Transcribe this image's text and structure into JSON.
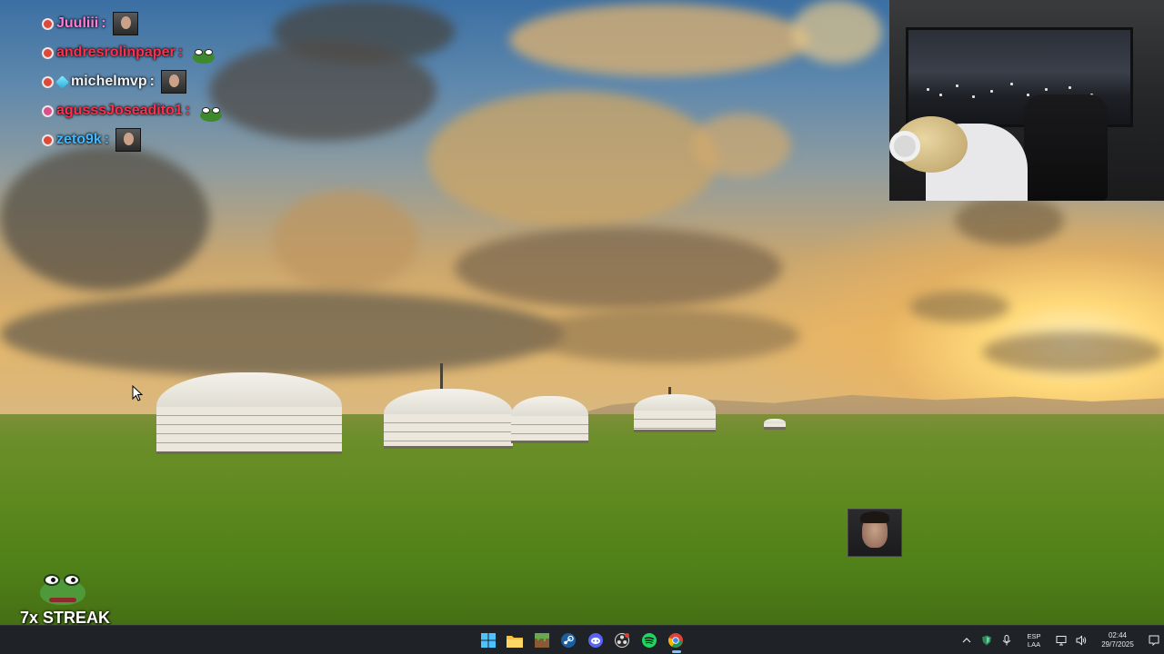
{
  "chat": {
    "messages": [
      {
        "user": "Juuliii",
        "color": "#ff7ad9",
        "badge_color": "#e0483a",
        "emote": "face"
      },
      {
        "user": "andresrolinpaper",
        "color": "#ff2e4c",
        "badge_color": "#e0483a",
        "emote": "pepe"
      },
      {
        "user": "michelmvp",
        "color": "#f2f2f2",
        "badge_color": "#e0483a",
        "extra_badge": "gem",
        "emote": "face"
      },
      {
        "user": "agusssJoseadito1",
        "color": "#ff2e4c",
        "badge_color": "#d9508c",
        "emote": "pepe"
      },
      {
        "user": "zeto9k",
        "color": "#3fb8ff",
        "badge_color": "#e0483a",
        "emote": "face"
      }
    ],
    "separator": ":"
  },
  "streak": {
    "label": "7x STREAK",
    "icon": "pepe-icon"
  },
  "taskbar": {
    "apps": [
      {
        "name": "start-button",
        "icon": "windows-icon"
      },
      {
        "name": "file-explorer-button",
        "icon": "folder-icon"
      },
      {
        "name": "minecraft-button",
        "icon": "grass-block-icon"
      },
      {
        "name": "steam-button",
        "icon": "steam-icon"
      },
      {
        "name": "discord-button",
        "icon": "discord-icon"
      },
      {
        "name": "obs-button",
        "icon": "obs-icon"
      },
      {
        "name": "spotify-button",
        "icon": "spotify-icon"
      },
      {
        "name": "chrome-button",
        "icon": "chrome-icon"
      }
    ],
    "tray": {
      "lang_line1": "ESP",
      "lang_line2": "LAA",
      "time": "02:44",
      "date": "29/7/2025"
    }
  },
  "colors": {
    "taskbar_bg": "#1f2327",
    "accent": "#8fbfe6"
  }
}
